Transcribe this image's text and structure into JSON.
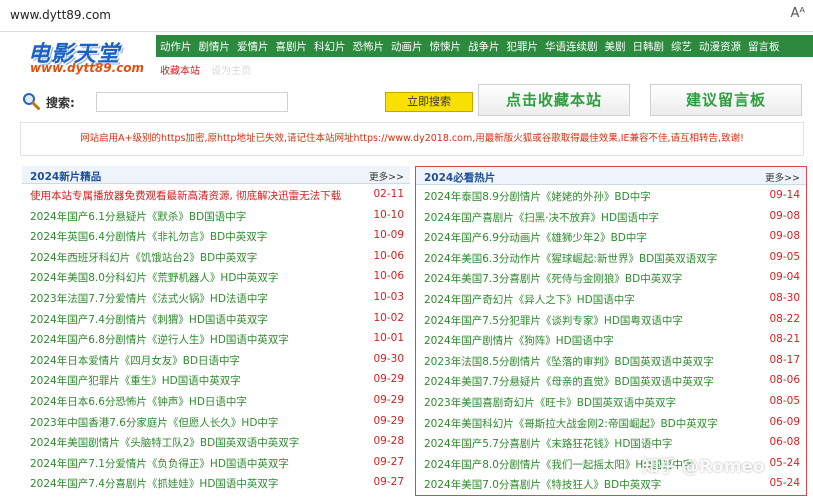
{
  "browser": {
    "url": "www.dytt89.com",
    "reader_label": "Aᴬ"
  },
  "logo": {
    "main": "电影天堂",
    "sub": "www.dytt89.com"
  },
  "nav": {
    "items": [
      "动作片",
      "剧情片",
      "爱情片",
      "喜剧片",
      "科幻片",
      "恐怖片",
      "动画片",
      "惊悚片",
      "战争片",
      "犯罪片",
      "华语连续剧",
      "美剧",
      "日韩剧",
      "综艺",
      "动漫资源",
      "留言板"
    ],
    "sub_items": [
      "收藏本站",
      "设为主页"
    ]
  },
  "search": {
    "label": "搜索:",
    "value": "",
    "button": "立即搜索"
  },
  "buttons": {
    "bookmark": "点击收藏本站",
    "message": "建议留言板"
  },
  "notice": "网站启用A+级别的https加密,原http地址已失效,请记住本站网址https://www.dy2018.com,用最新版火狐或谷歌取得最佳效果,IE兼容不佳,请互相转告,致谢!",
  "left_list": {
    "title": "2024新片精品",
    "more": "更多>>",
    "items": [
      {
        "title": "使用本站专属播放器免费观看最新高清资源, 彻底解决迅雷无法下载",
        "date": "02-11"
      },
      {
        "title": "2024年国产6.1分悬疑片《默杀》BD国语中字",
        "date": "10-10"
      },
      {
        "title": "2024年英国6.4分剧情片《非礼勿言》BD中英双字",
        "date": "10-09"
      },
      {
        "title": "2024年西班牙科幻片《饥饿站台2》BD中英双字",
        "date": "10-06"
      },
      {
        "title": "2024年美国8.0分科幻片《荒野机器人》HD中英双字",
        "date": "10-06"
      },
      {
        "title": "2023年法国7.7分爱情片《法式火锅》HD法语中字",
        "date": "10-03"
      },
      {
        "title": "2024年国产7.4分剧情片《刺猬》HD国语中英双字",
        "date": "10-02"
      },
      {
        "title": "2024年国产6.8分剧情片《逆行人生》HD国语中英双字",
        "date": "10-01"
      },
      {
        "title": "2024年日本爱情片《四月女友》BD日语中字",
        "date": "09-30"
      },
      {
        "title": "2024年国产犯罪片《重生》HD国语中英双字",
        "date": "09-29"
      },
      {
        "title": "2024年日本6.6分恐怖片《钟声》HD日语中字",
        "date": "09-29"
      },
      {
        "title": "2023年中国香港7.6分家庭片《但愿人长久》HD中字",
        "date": "09-29"
      },
      {
        "title": "2024年美国剧情片《头脑特工队2》BD国英双语中英双字",
        "date": "09-28"
      },
      {
        "title": "2024年国产7.1分爱情片《负负得正》HD国语中英双字",
        "date": "09-27"
      },
      {
        "title": "2024年国产7.4分喜剧片《抓娃娃》HD国语中英双字",
        "date": "09-27"
      }
    ]
  },
  "right_list": {
    "title": "2024必看热片",
    "more": "更多>>",
    "items": [
      {
        "title": "2024年泰国8.9分剧情片《姥姥的外孙》BD中字",
        "date": "09-14"
      },
      {
        "title": "2024年国产喜剧片《扫黑·决不放弃》HD国语中字",
        "date": "09-08"
      },
      {
        "title": "2024年国产6.9分动画片《雄狮少年2》BD中字",
        "date": "09-08"
      },
      {
        "title": "2024年美国6.3分动作片《猩球崛起:新世界》BD国英双语双字",
        "date": "09-05"
      },
      {
        "title": "2024年美国7.3分喜剧片《死侍与金刚狼》BD中英双字",
        "date": "09-04"
      },
      {
        "title": "2024年国产奇幻片《异人之下》HD国语中字",
        "date": "08-30"
      },
      {
        "title": "2024年国产7.5分犯罪片《谈判专家》HD国粤双语中字",
        "date": "08-22"
      },
      {
        "title": "2024年国产剧情片《狗阵》HD国语中字",
        "date": "08-21"
      },
      {
        "title": "2023年法国8.5分剧情片《坠落的审判》BD国英双语中英双字",
        "date": "08-17"
      },
      {
        "title": "2024年美国7.7分悬疑片《母亲的直觉》BD国英双语中英双字",
        "date": "08-06"
      },
      {
        "title": "2023年美国喜剧奇幻片《旺卡》BD国英双语中英双字",
        "date": "08-05"
      },
      {
        "title": "2024年美国科幻片《哥斯拉大战金刚2:帝国崛起》BD中英双字",
        "date": "06-09"
      },
      {
        "title": "2024年国产5.7分喜剧片《末路狂花钱》HD国语中字",
        "date": "06-08"
      },
      {
        "title": "2024年国产8.0分剧情片《我们一起摇太阳》HD国语中字",
        "date": "05-24"
      },
      {
        "title": "2024年美国7.0分喜剧片《特技狂人》BD中英双字",
        "date": "05-24"
      }
    ]
  },
  "watermark": "知乎 @Romeo",
  "colors": {
    "nav_green": "#2b8a3e",
    "title_green": "#2e8b2e",
    "date_red": "#d61f1f",
    "header_blue": "#1f4e9c",
    "button_yellow": "#f8e000"
  }
}
